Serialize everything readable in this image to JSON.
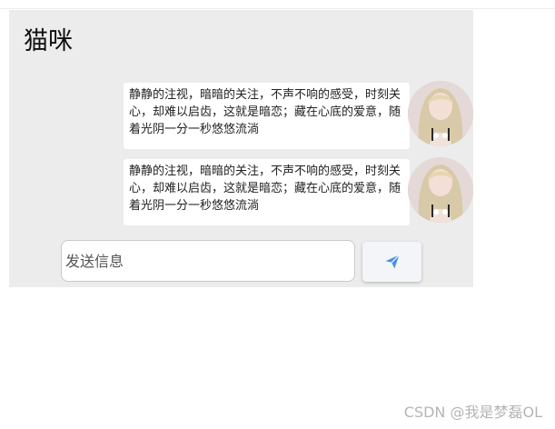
{
  "chat": {
    "title": "猫咪",
    "messages": [
      {
        "text": "静静的注视，暗暗的关注，不声不响的感受，时刻关心，却难以启齿，这就是暗恋；藏在心底的爱意，随着光阴一分一秒悠悠流淌",
        "avatar": "girl-avatar"
      },
      {
        "text": "静静的注视，暗暗的关注，不声不响的感受，时刻关心，却难以启齿，这就是暗恋；藏在心底的爱意，随着光阴一分一秒悠悠流淌",
        "avatar": "girl-avatar"
      }
    ]
  },
  "composer": {
    "placeholder": "发送信息",
    "value": "",
    "send_icon": "send-icon"
  },
  "watermark": "CSDN @我是梦磊OL",
  "colors": {
    "panel_bg": "#ececec",
    "bubble_bg": "#ffffff",
    "send_icon": "#4a90e2"
  }
}
